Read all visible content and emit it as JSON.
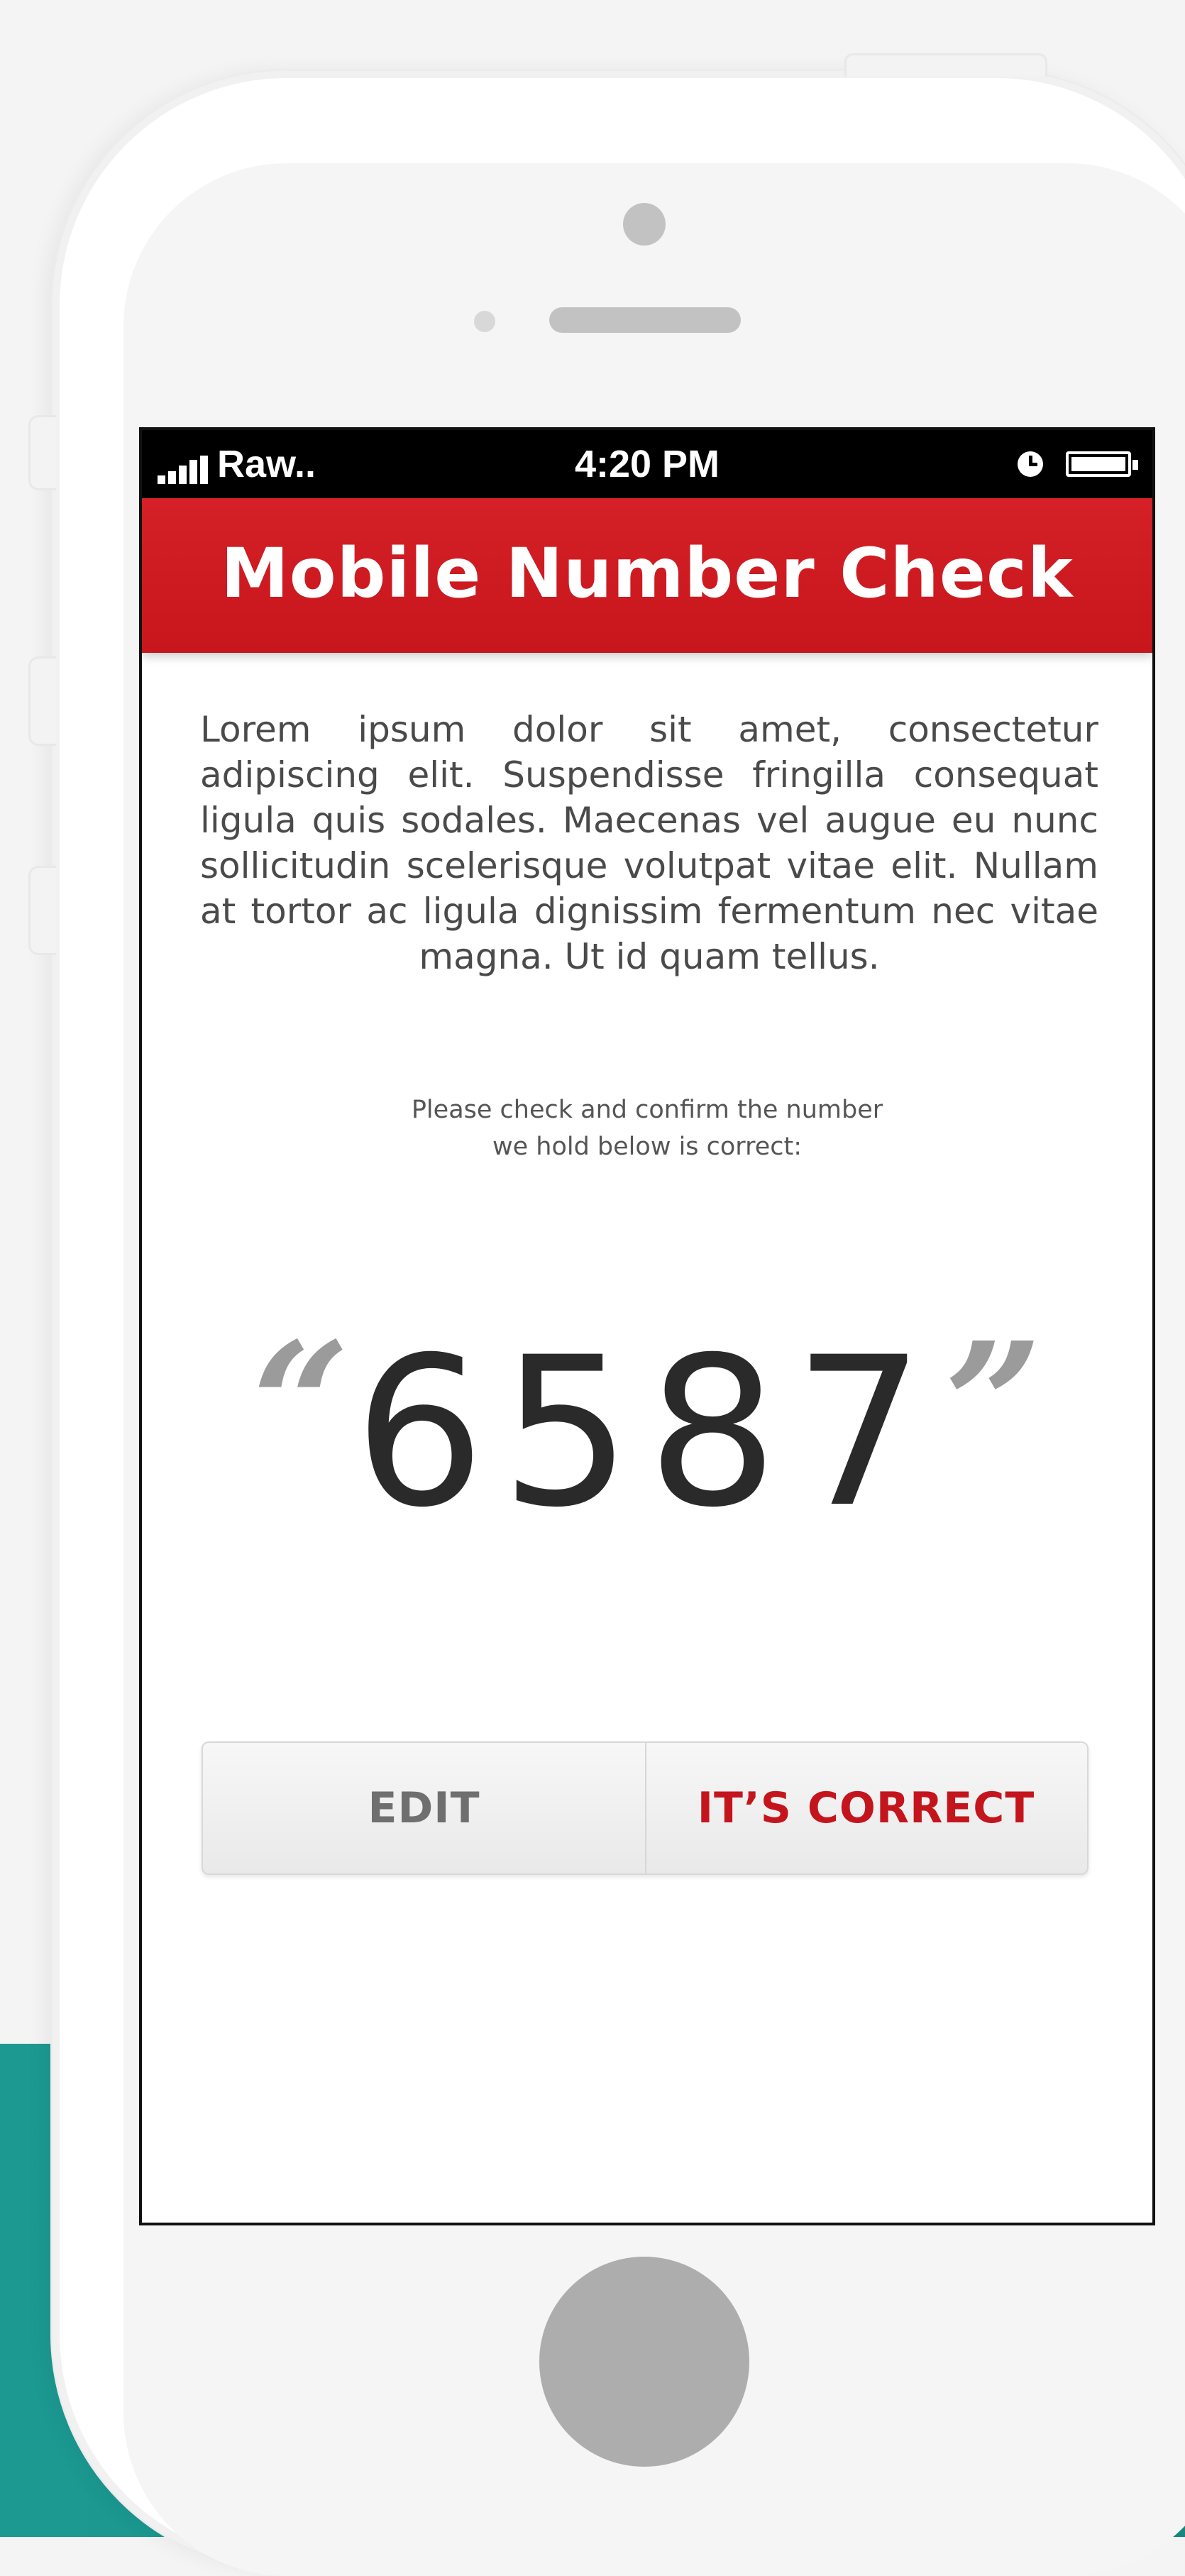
{
  "colors": {
    "background": "#f4f4f5",
    "accent_teal": "#16877f",
    "header_red": "#c8161d",
    "correct_button_text": "#c4151d",
    "edit_button_text": "#6f6f6f",
    "number_text": "#2a2a2a",
    "quote_marks": "#9b9b9b"
  },
  "status_bar": {
    "carrier": "Raw..",
    "time": "4:20 PM",
    "signal_icon": "signal-bars-icon",
    "alarm_icon": "clock-icon",
    "battery_icon": "battery-icon"
  },
  "header": {
    "title": "Mobile Number Check"
  },
  "content": {
    "body": "Lorem ipsum dolor sit amet, consectetur adipiscing elit. Suspendisse fringilla consequat ligula quis sodales. Maecenas vel augue eu nunc sollicitudin scelerisque volutpat vitae elit. Nullam at tortor ac ligula dignissim fermentum nec vitae magna. Ut id quam tellus.",
    "prompt_line1": "Please check and confirm the number",
    "prompt_line2": "we hold below is correct:",
    "number": "6587",
    "open_quote": "“",
    "close_quote": "”"
  },
  "buttons": {
    "edit": "EDIT",
    "correct": "IT’S CORRECT"
  }
}
